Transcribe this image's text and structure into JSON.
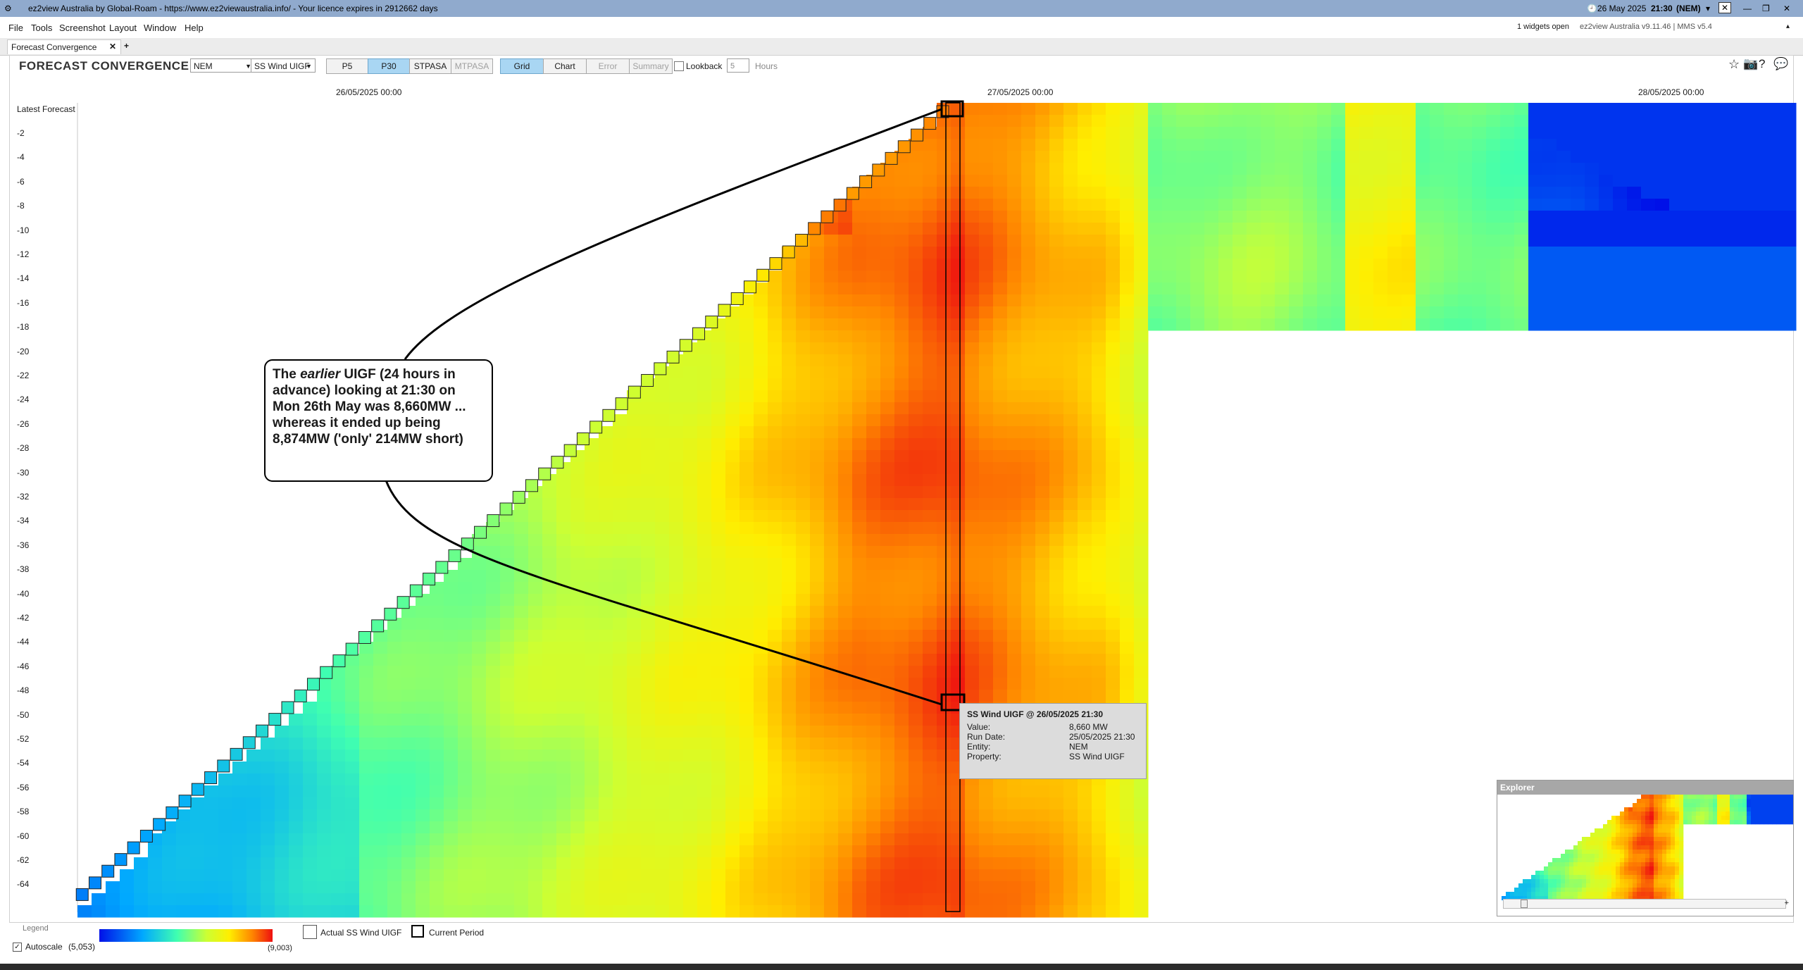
{
  "window": {
    "title": "ez2view Australia by Global-Roam - https://www.ez2viewaustralia.info/ - Your licence expires in 2912662 days",
    "datetime": "26 May 2025",
    "time": "21:30",
    "market": "(NEM)",
    "widgets_open": "1 widgets open",
    "version": "ez2view Australia v9.11.46 | MMS v5.4"
  },
  "menu": [
    "File",
    "Tools",
    "Screenshot",
    "Layout",
    "Window",
    "Help"
  ],
  "tabs": [
    {
      "label": "Forecast Convergence"
    }
  ],
  "widget": {
    "title": "FORECAST CONVERGENCE",
    "region": "NEM",
    "metric": "SS Wind UIGF",
    "run_types": [
      "P5",
      "P30",
      "STPASA",
      "MTPASA"
    ],
    "active_run_type": "P30",
    "views": [
      "Grid",
      "Chart",
      "Error",
      "Summary"
    ],
    "active_view": "Grid",
    "lookback_label": "Lookback",
    "lookback_value": "5",
    "lookback_unit": "Hours"
  },
  "grid": {
    "x_labels": [
      "26/05/2025 00:00",
      "27/05/2025 00:00",
      "28/05/2025 00:00"
    ],
    "y_first_label": "Latest Forecast",
    "y_labels": [
      "-2",
      "-4",
      "-6",
      "-8",
      "-10",
      "-12",
      "-14",
      "-16",
      "-18",
      "-20",
      "-22",
      "-24",
      "-26",
      "-28",
      "-30",
      "-32",
      "-34",
      "-36",
      "-38",
      "-40",
      "-42",
      "-44",
      "-46",
      "-48",
      "-50",
      "-52",
      "-54",
      "-56",
      "-58",
      "-60",
      "-62",
      "-64"
    ],
    "color_scale_min": 5053,
    "color_scale_max": 9003
  },
  "callout": {
    "prefix": "The ",
    "emph": "earlier",
    "rest": " UIGF (24 hours in advance) looking at 21:30 on Mon 26th May was 8,660MW ... whereas it ended up being 8,874MW ('only' 214MW short)"
  },
  "tooltip": {
    "title": "SS Wind UIGF @ 26/05/2025 21:30",
    "rows": [
      {
        "k": "Value:",
        "v": "8,660 MW"
      },
      {
        "k": "Run Date:",
        "v": "25/05/2025 21:30"
      },
      {
        "k": "Entity:",
        "v": "NEM"
      },
      {
        "k": "Property:",
        "v": "SS Wind UIGF"
      }
    ]
  },
  "legend": {
    "title": "Legend",
    "autoscale": "Autoscale",
    "min_label": "(5,053)",
    "max_label": "(9,003)",
    "actual_label": "Actual SS Wind UIGF",
    "current_label": "Current Period"
  },
  "explorer": {
    "title": "Explorer"
  }
}
